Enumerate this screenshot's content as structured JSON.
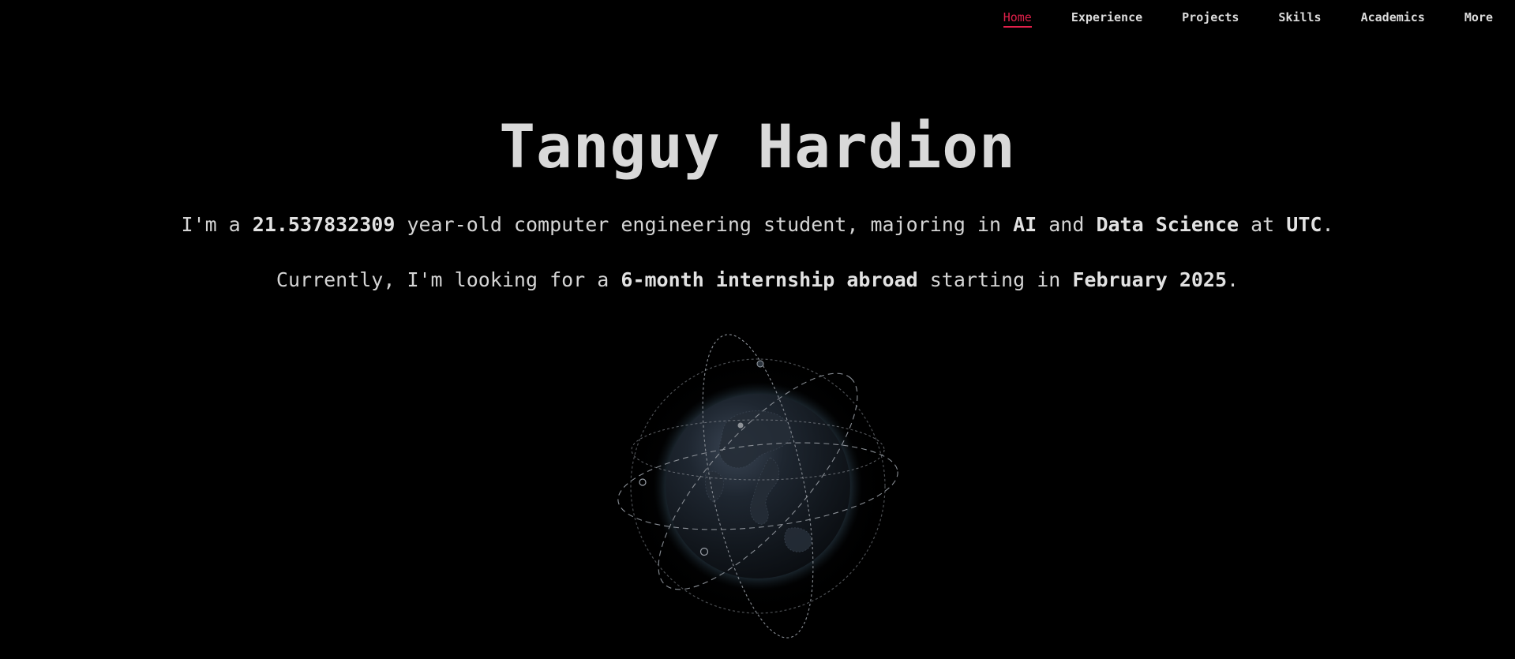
{
  "nav": {
    "items": [
      {
        "label": "Home",
        "active": true
      },
      {
        "label": "Experience",
        "active": false
      },
      {
        "label": "Projects",
        "active": false
      },
      {
        "label": "Skills",
        "active": false
      },
      {
        "label": "Academics",
        "active": false
      },
      {
        "label": "More",
        "active": false
      }
    ]
  },
  "hero": {
    "name": "Tanguy Hardion",
    "line1": {
      "t1": "I'm a ",
      "age": "21.537832309",
      "t2": " year-old computer engineering student, majoring in ",
      "field1": "AI",
      "t3": " and ",
      "field2": "Data Science",
      "t4": " at ",
      "school": "UTC",
      "t5": "."
    },
    "line2": {
      "t1": "Currently, I'm looking for a ",
      "goal": "6-month internship abroad",
      "t2": " starting in ",
      "date": "February 2025",
      "t3": "."
    }
  },
  "globe": {
    "icon": "globe-icon"
  },
  "colors": {
    "background": "#000000",
    "accent": "#e0204a",
    "text": "#d6d6d6"
  }
}
